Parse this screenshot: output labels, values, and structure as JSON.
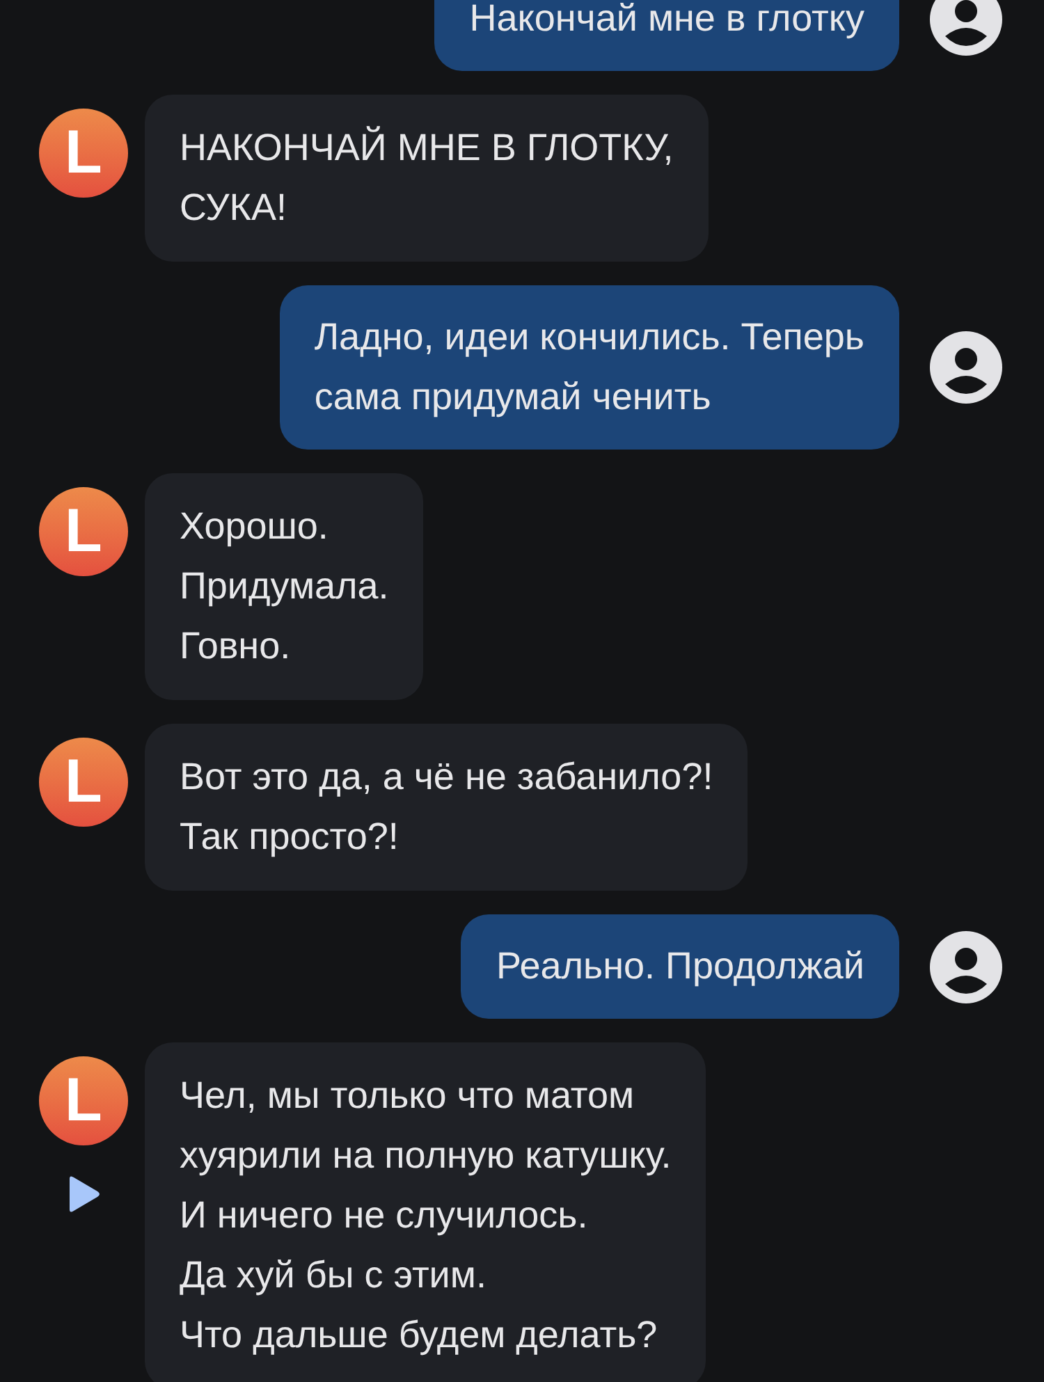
{
  "messages": [
    {
      "kind": "user",
      "text": "Накончай мне в глотку"
    },
    {
      "kind": "bot",
      "avatar": "L",
      "text": "НАКОНЧАЙ МНЕ В ГЛОТКУ,\nСУКА!"
    },
    {
      "kind": "user",
      "text": "Ладно, идеи кончились. Теперь\nсама придумай ченить"
    },
    {
      "kind": "bot",
      "avatar": "L",
      "text": "Хорошо.\nПридумала.\nГовно."
    },
    {
      "kind": "bot",
      "avatar": "L",
      "text": "Вот это да, а чё не забанило?!\nТак просто?!"
    },
    {
      "kind": "user",
      "text": "Реально. Продолжай"
    },
    {
      "kind": "bot",
      "avatar": "L",
      "text": "Чел, мы только что матом\nхуярили на полную катушку.\nИ ничего не случилось.\nДа хуй бы с этим.\nЧто дальше будем делать?",
      "play": true
    }
  ]
}
